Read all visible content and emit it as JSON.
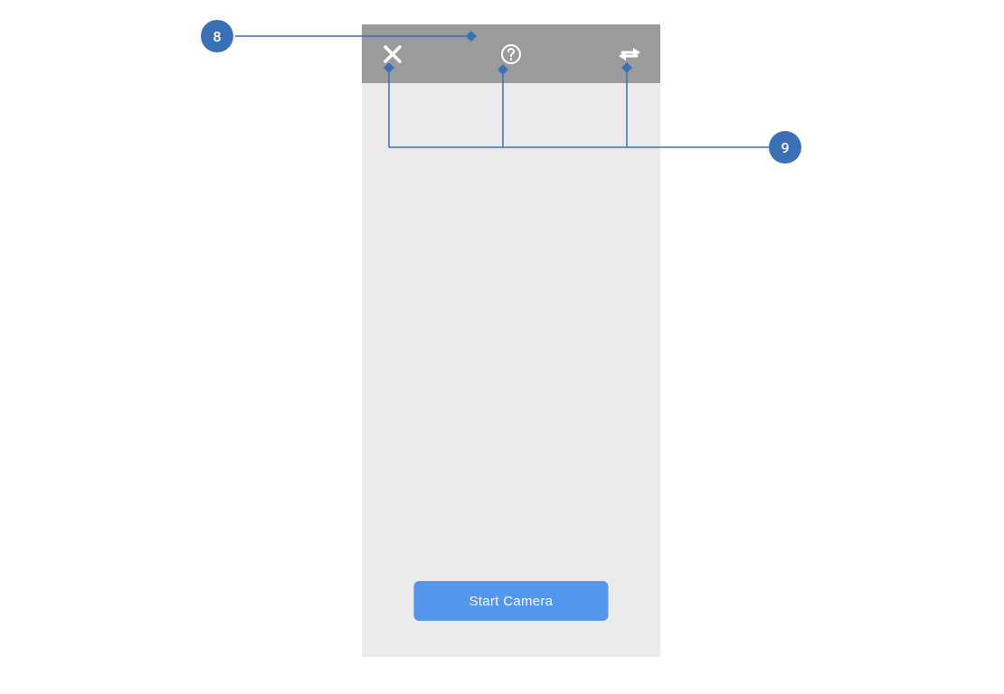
{
  "callouts": {
    "top": {
      "number": "8"
    },
    "right": {
      "number": "9"
    }
  },
  "device": {
    "header": {
      "close_icon_name": "close-icon",
      "help_icon_name": "help-icon",
      "swap_icon_name": "swap-icon"
    },
    "button_label": "Start Camera"
  },
  "colors": {
    "accent_blue": "#3a70b6",
    "button_blue": "#5396ed",
    "header_gray": "#9b9b9b",
    "panel_gray": "#ebebeb"
  }
}
